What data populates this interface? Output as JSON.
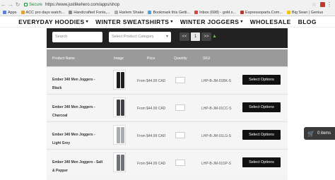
{
  "browser": {
    "secure_label": "Secure",
    "url": "https://www.justlikehero.com/apps/shop",
    "bookmarks": [
      {
        "label": "Apps",
        "color": "#5a7fd6"
      },
      {
        "label": "ACC pro days watch...",
        "color": "#e2a233"
      },
      {
        "label": "Handcrafted Fonts,...",
        "color": "#888888"
      },
      {
        "label": "Harlem Shake",
        "color": "#aaaaaa"
      },
      {
        "label": "Bookmark this Getti...",
        "color": "#4ea0d8"
      },
      {
        "label": "Inbox (698) - gold.x...",
        "color": "#d64541"
      },
      {
        "label": "Espressoparts.Com...",
        "color": "#b03a2e"
      },
      {
        "label": "Big Sean | Genius",
        "color": "#f1c40f"
      }
    ]
  },
  "nav": {
    "items": [
      {
        "label": "EVERYDAY HOODIES"
      },
      {
        "label": "WINTER SWEATSHIRTS"
      },
      {
        "label": "WINTER JOGGERS"
      },
      {
        "label": "WHOLESALE"
      },
      {
        "label": "BLOG"
      }
    ]
  },
  "toolbar": {
    "search_placeholder": "Search",
    "category_placeholder": "Select Product Category",
    "prev_label": "<<",
    "page_label": "1",
    "next_label": ">>"
  },
  "table": {
    "headers": [
      "Product Name",
      "Image",
      "Price",
      "Quantity",
      "SKU"
    ],
    "rows": [
      {
        "name": "Ember 340 Men Joggers - Black",
        "price": "From $44.99 CAD",
        "sku": "LHP-B-JM-01BK-S",
        "button": "Select Options",
        "leg_color": "#1e1e1e"
      },
      {
        "name": "Ember 340 Men Joggers - Charcoal",
        "price": "From $44.99 CAD",
        "sku": "LHP-B-JM-01CC-S",
        "button": "Select Options",
        "leg_color": "#3d3f44"
      },
      {
        "name": "Ember 340 Men Joggers - Light Grey",
        "price": "From $44.99 CAD",
        "sku": "LHP-B-JM-01LG-S",
        "button": "Select Options",
        "leg_color": "#a8acb0"
      },
      {
        "name": "Ember 340 Men Joggers - Salt & Pepper",
        "price": "From $44.99 CAD",
        "sku": "LHP-B-JM-01SP-S",
        "button": "Select Options",
        "leg_color": "#6f7276"
      }
    ]
  },
  "cart": {
    "label": "0 items"
  }
}
